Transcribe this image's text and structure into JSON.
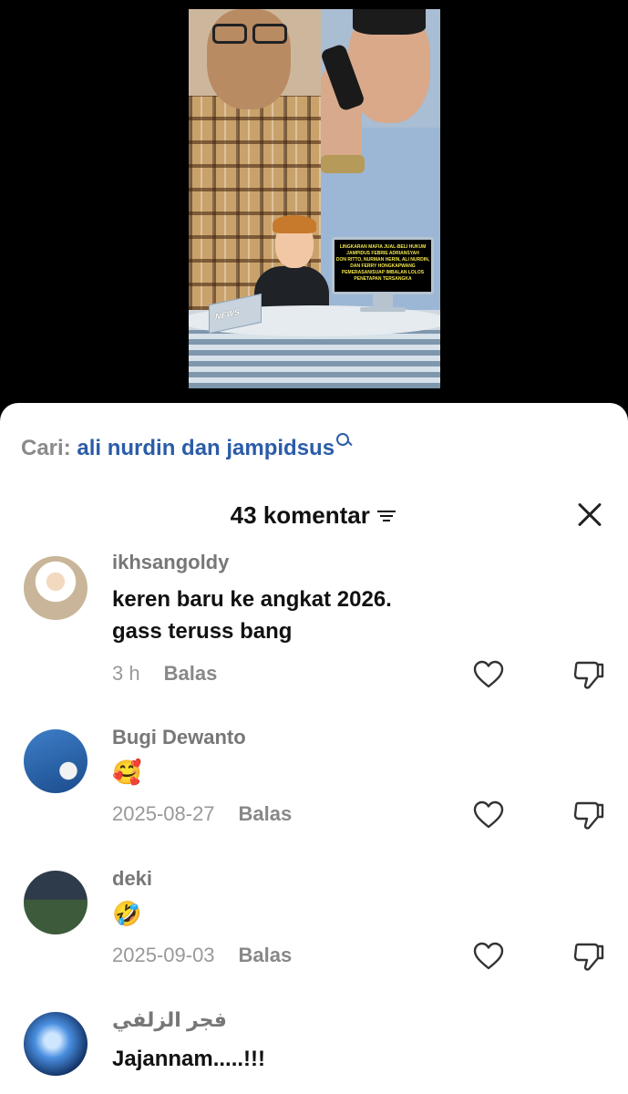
{
  "video": {
    "badge_text": "NEWS",
    "monitor_lines": [
      "LINGKARAN MAFIA JUAL-BELI HUKUM",
      "JAMPIDUS FEBRIE ADRIANSYAH",
      "DON RITTO, NURMAN HERIN, ALI NURDIN,",
      "DAN FERRY HONGKAPWANG",
      "PEMERASAN/SUAP IMBALAN LOLOS",
      "PENETAPAN TERSANGKA"
    ]
  },
  "search": {
    "prefix": "Cari:",
    "query": "ali nurdin dan jampidsus"
  },
  "header": {
    "count_label": "43 komentar"
  },
  "comments": [
    {
      "username": "ikhsangoldy",
      "lines": [
        "keren baru ke angkat 2026.",
        "gass teruss bang"
      ],
      "time": "3 h",
      "reply": "Balas"
    },
    {
      "username": "Bugi Dewanto",
      "emoji": "🥰",
      "time": "2025-08-27",
      "reply": "Balas"
    },
    {
      "username": "deki",
      "emoji": "🤣",
      "time": "2025-09-03",
      "reply": "Balas"
    },
    {
      "username": "فجر الزلفي",
      "lines": [
        "Jajannam.....!!!"
      ]
    }
  ],
  "colors": {
    "search_query": "#2b5ca8",
    "sheet_bg": "#ffffff",
    "video_bg": "#000000"
  }
}
